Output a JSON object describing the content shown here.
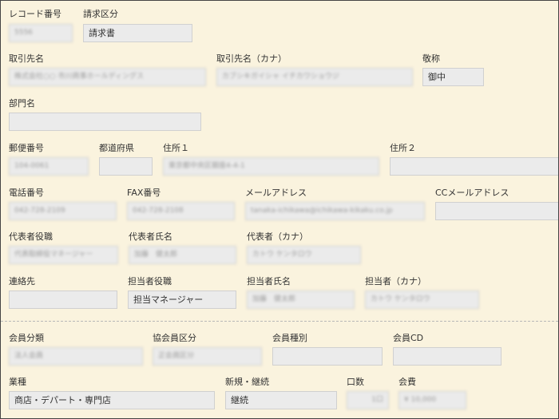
{
  "labels": {
    "record_no": "レコード番号",
    "billing_type": "請求区分",
    "client_name": "取引先名",
    "client_name_kana": "取引先名（カナ）",
    "honorific": "敬称",
    "department": "部門名",
    "postal_code": "郵便番号",
    "prefecture": "都道府県",
    "address1": "住所１",
    "address2": "住所２",
    "phone": "電話番号",
    "fax": "FAX番号",
    "email": "メールアドレス",
    "cc_email": "CCメールアドレス",
    "rep_title": "代表者役職",
    "rep_name": "代表者氏名",
    "rep_kana": "代表者（カナ）",
    "contact": "連絡先",
    "person_title": "担当者役職",
    "person_name": "担当者氏名",
    "person_kana": "担当者（カナ）",
    "member_class": "会員分類",
    "assoc_member_class": "協会員区分",
    "member_type": "会員種別",
    "member_cd": "会員CD",
    "industry": "業種",
    "new_continue": "新規・継続",
    "units": "口数",
    "fee": "会費"
  },
  "values": {
    "record_no": "5556",
    "billing_type": "請求書",
    "client_name": "株式会社○○ 市川商事ホールディングス",
    "client_name_kana": "カブシキガイシャ イチカワショウジ",
    "honorific": "御中",
    "department": "",
    "postal_code": "104-0061",
    "prefecture": "",
    "address1": "東京都中央区銀座4-4-1",
    "address2": "",
    "phone": "042-728-2109",
    "fax": "042-728-2108",
    "email": "tanaka-ichikawa@ichikawa-kikaku.co.jp",
    "cc_email": "",
    "rep_title": "代表取締役マネージャー",
    "rep_name": "加藤　健太郎",
    "rep_kana": "カトウ ケンタロウ",
    "contact": "",
    "person_title": "担当マネージャー",
    "person_name": "加藤　健太郎",
    "person_kana": "カトウ ケンタロウ",
    "member_class": "法人会員",
    "assoc_member_class": "正会員区分",
    "member_type": "",
    "member_cd": "",
    "industry": "商店・デパート・専門店",
    "new_continue": "継続",
    "units": "1口",
    "fee": "¥ 10,000"
  }
}
